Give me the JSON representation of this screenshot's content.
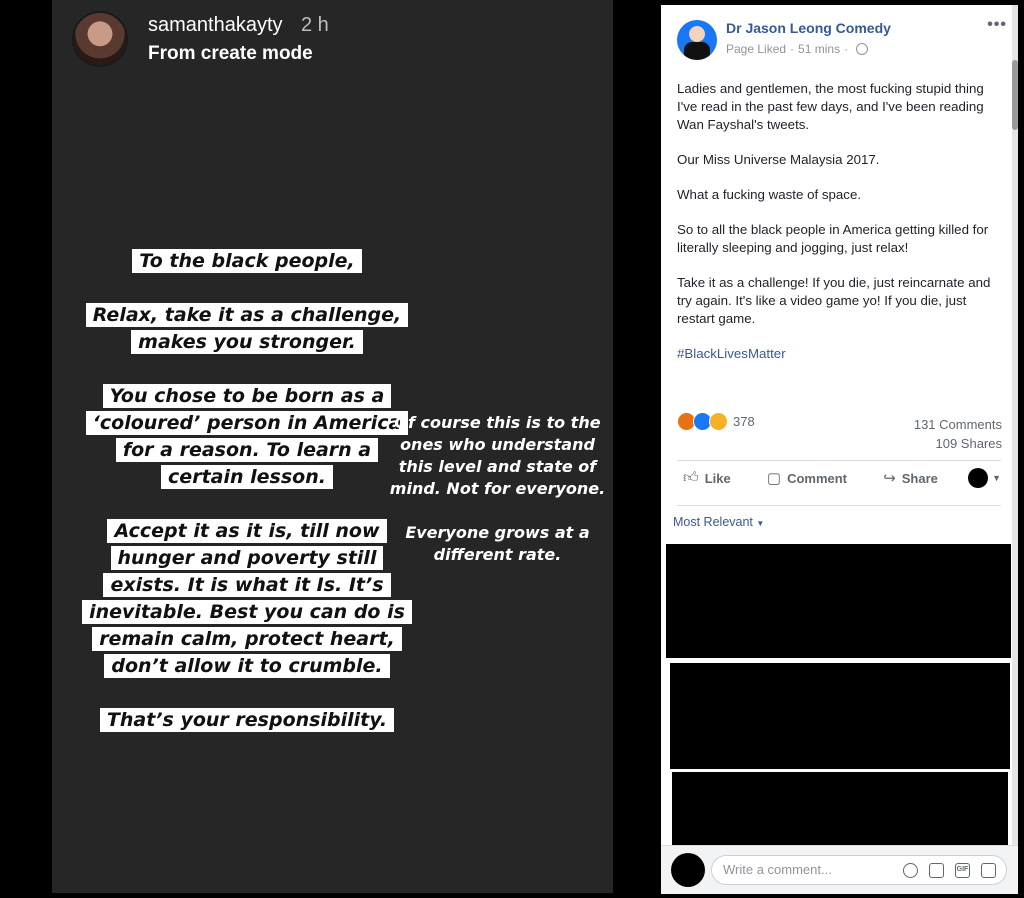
{
  "story": {
    "username": "samanthakayty",
    "time": "2 h",
    "mode": "From create mode",
    "left_paragraphs": [
      "To the black people,",
      "Relax, take it as a challenge, makes you stronger.",
      "You chose to be born as a ‘coloured’ person in America for a reason. To learn a certain lesson.",
      "Accept it as it is, till now hunger and poverty still exists. It is what it Is. It’s inevitable. Best you can do is remain calm, protect heart, don’t allow it to crumble.",
      "That’s your responsibility."
    ],
    "right_paragraphs": [
      "Of course this is to the ones who understand this level and state of mind. Not for everyone.",
      "Everyone grows at a different rate."
    ]
  },
  "facebook": {
    "page_name": "Dr Jason Leong Comedy",
    "status": "Page Liked",
    "time": "51 mins",
    "post_paragraphs": [
      "Ladies and gentlemen, the most fucking stupid thing I've read in the past few days, and I've been reading Wan Fayshal's tweets.",
      "Our Miss Universe Malaysia 2017.",
      "What a fucking waste of space.",
      "So to all the black people in America getting killed for literally sleeping and jogging, just relax!",
      "Take it as a challenge! If you die, just reincarnate and try again. It's like a video game yo! If you die, just restart game."
    ],
    "hashtag": "#BlackLivesMatter",
    "reaction_count": "378",
    "comments": "131 Comments",
    "shares": "109 Shares",
    "actions": {
      "like": "Like",
      "comment": "Comment",
      "share": "Share"
    },
    "sort_label": "Most Relevant",
    "comment_placeholder": "Write a comment..."
  }
}
